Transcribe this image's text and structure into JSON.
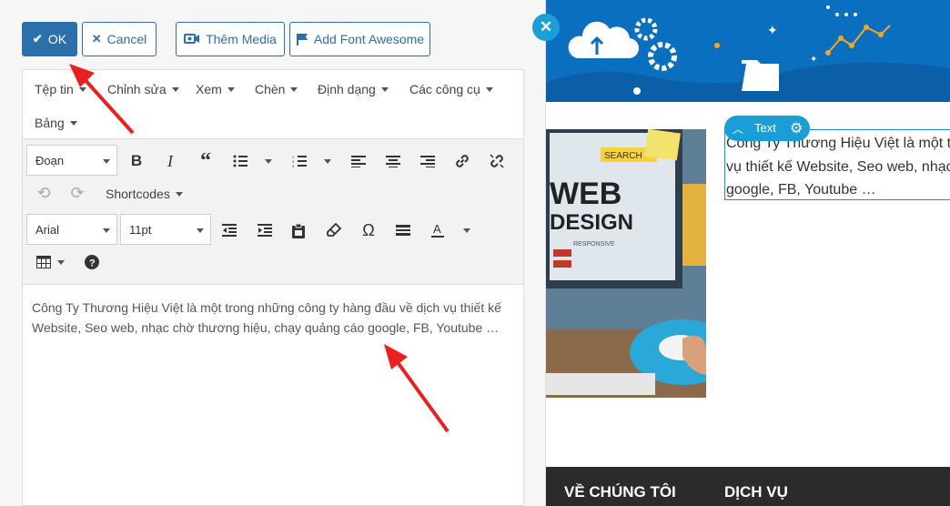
{
  "actions": {
    "ok_label": "OK",
    "cancel_label": "Cancel",
    "media_label": "Thêm Media",
    "font_awesome_label": "Add Font Awesome"
  },
  "menubar": {
    "file": "Tệp tin",
    "edit": "Chỉnh sửa",
    "view": "Xem",
    "insert": "Chèn",
    "format": "Định dạng",
    "tools": "Các công cụ",
    "table": "Bảng"
  },
  "toolbar": {
    "block_format": "Đoạn",
    "shortcodes": "Shortcodes",
    "font_family": "Arial",
    "font_size": "11pt"
  },
  "content": {
    "text": "Công Ty Thương Hiệu Việt là một trong những công ty hàng đầu về dịch vụ thiết kế Website, Seo web, nhạc chờ thương hiệu, chạy quảng cáo google, FB, Youtube …"
  },
  "preview": {
    "widget_label": "Text",
    "text_line1": "Công Ty Thương Hiệu Việt là một tr",
    "text_line2": "vụ thiết kế Website, Seo web, nhạc",
    "text_line3": "google, FB, Youtube …",
    "footer_col1": "VỀ CHÚNG TÔI",
    "footer_col2": "DỊCH VỤ",
    "photo_sign_line1": "WEB",
    "photo_sign_line2": "DESIGN",
    "photo_sign_small": "RESPONSIVE",
    "photo_search": "SEARCH"
  },
  "colors": {
    "primary": "#2b6fab",
    "accent": "#1a9ed8",
    "arrow": "#e8201e",
    "footer": "#2b2b2b"
  }
}
